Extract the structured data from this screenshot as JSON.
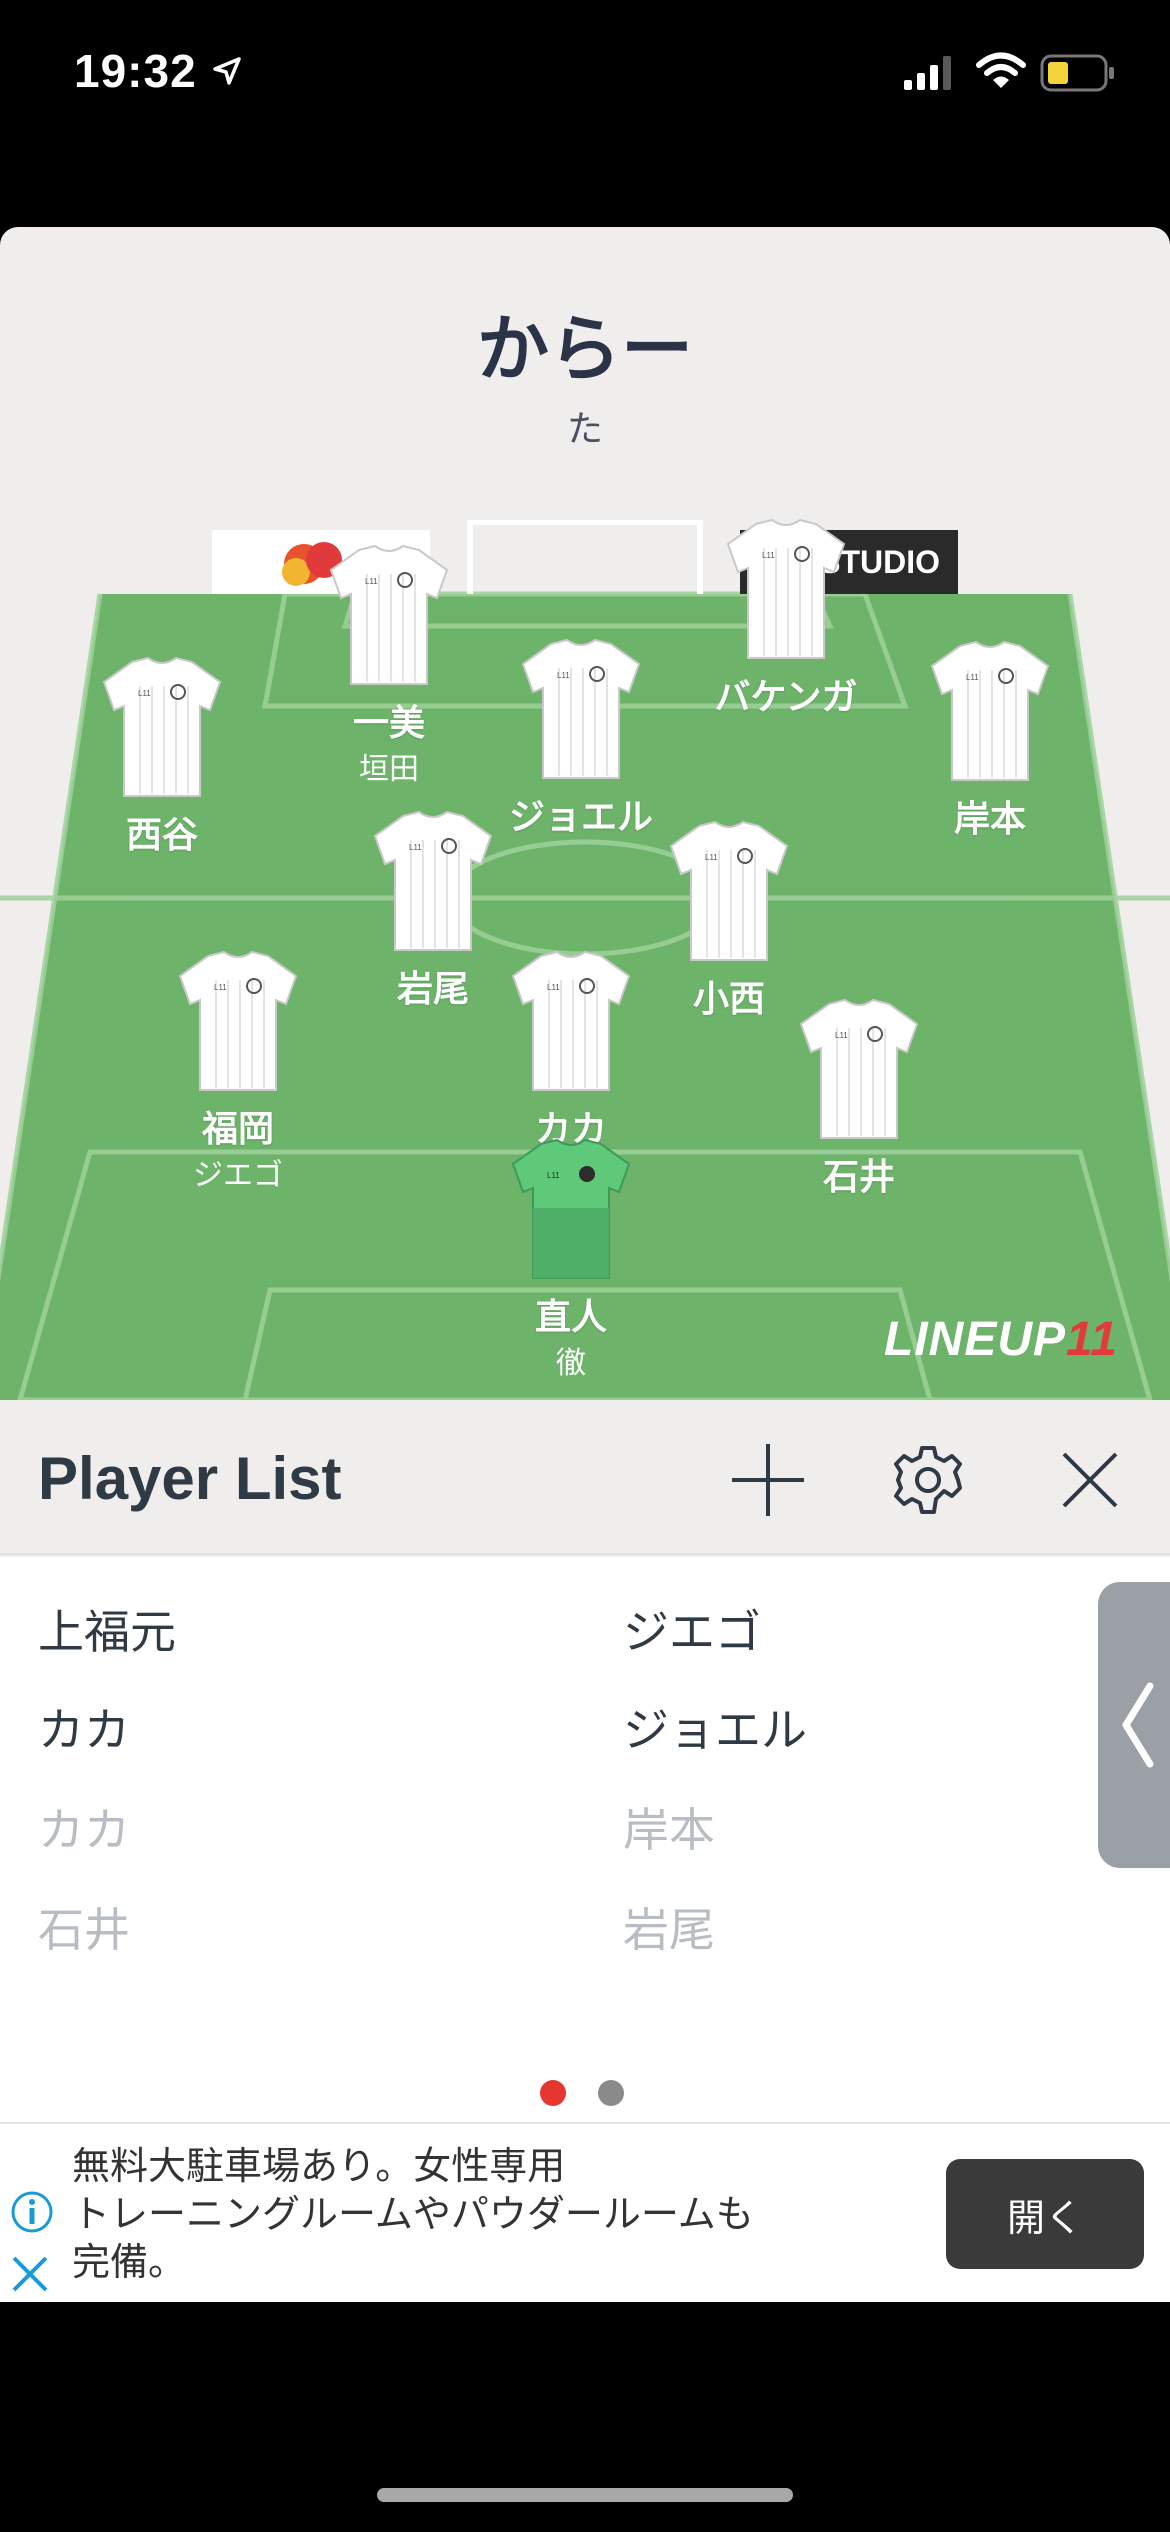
{
  "status_bar": {
    "time": "19:32",
    "location_icon": "location-arrow-icon",
    "signal_icon": "cellular-signal-icon",
    "wifi_icon": "wifi-icon",
    "battery_icon": "battery-low-icon",
    "battery_color": "#f3d43b"
  },
  "team": {
    "name": "からー",
    "subtitle": "た"
  },
  "field": {
    "grass_color": "#6db46a",
    "ad_board_right": "S STUDIO",
    "logo_text": "LINEUP",
    "logo_number": "11",
    "players": [
      {
        "name": "一美",
        "sub": "垣田",
        "kit": "outfield"
      },
      {
        "name": "バケンガ",
        "sub": "",
        "kit": "outfield"
      },
      {
        "name": "西谷",
        "sub": "",
        "kit": "outfield"
      },
      {
        "name": "ジョエル",
        "sub": "",
        "kit": "outfield"
      },
      {
        "name": "岸本",
        "sub": "",
        "kit": "outfield"
      },
      {
        "name": "岩尾",
        "sub": "",
        "kit": "outfield"
      },
      {
        "name": "小西",
        "sub": "",
        "kit": "outfield"
      },
      {
        "name": "福岡",
        "sub": "ジエゴ",
        "kit": "outfield"
      },
      {
        "name": "カカ",
        "sub": "",
        "kit": "outfield"
      },
      {
        "name": "石井",
        "sub": "",
        "kit": "outfield"
      },
      {
        "name": "直人",
        "sub": "徹",
        "kit": "goalkeeper"
      }
    ]
  },
  "player_list": {
    "title": "Player List",
    "add_icon": "plus-icon",
    "settings_icon": "gear-icon",
    "close_icon": "close-icon",
    "items": [
      {
        "label": "上福元",
        "dim": false
      },
      {
        "label": "ジエゴ",
        "dim": false
      },
      {
        "label": "カカ",
        "dim": false
      },
      {
        "label": "ジョエル",
        "dim": false
      },
      {
        "label": "カカ",
        "dim": true
      },
      {
        "label": "岸本",
        "dim": true
      },
      {
        "label": "石井",
        "dim": true
      },
      {
        "label": "岩尾",
        "dim": true
      }
    ],
    "side_tab_icon": "chevron-left-icon",
    "page_count": 2,
    "active_page": 1,
    "active_dot_color": "#e5372f",
    "inactive_dot_color": "#8a8a8a"
  },
  "ad": {
    "text_line1": "無料大駐車場あり。女性専用",
    "text_line2": "トレーニングルームやパウダールームも",
    "text_line3": "完備。",
    "button_label": "開く",
    "info_icon": "info-icon",
    "close_icon": "close-icon"
  }
}
